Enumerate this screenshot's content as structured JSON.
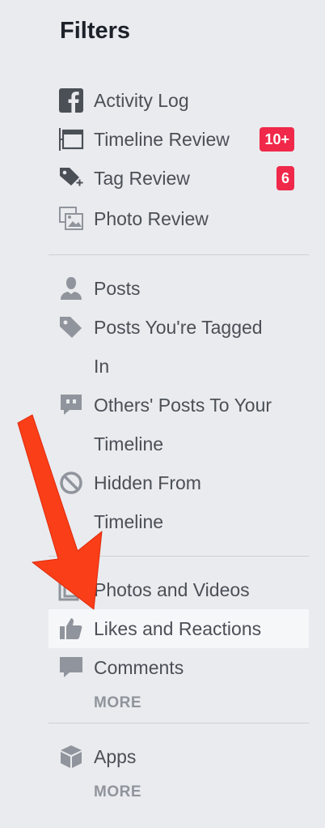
{
  "filters": {
    "title": "Filters",
    "group1": [
      {
        "label": "Activity Log",
        "icon": "facebook-f-icon"
      },
      {
        "label": "Timeline Review",
        "icon": "timeline-review-icon",
        "badge": "10+"
      },
      {
        "label": "Tag Review",
        "icon": "tag-plus-icon",
        "badge": "6"
      },
      {
        "label": "Photo Review",
        "icon": "photo-review-icon"
      }
    ],
    "group2": [
      {
        "label": "Posts",
        "icon": "person-icon"
      },
      {
        "label_line1": "Posts You're Tagged",
        "label_line2": "In",
        "icon": "tag-icon"
      },
      {
        "label_line1": "Others' Posts To Your",
        "label_line2": "Timeline",
        "icon": "speech-bubble-quote-icon"
      },
      {
        "label_line1": "Hidden From",
        "label_line2": "Timeline",
        "icon": "blocked-circle-icon"
      }
    ],
    "group3": [
      {
        "label": "Photos and Videos",
        "icon": "photos-icon"
      },
      {
        "label": "Likes and Reactions",
        "icon": "thumbs-up-icon",
        "selected": true
      },
      {
        "label": "Comments",
        "icon": "comment-icon"
      }
    ],
    "group3_more": "MORE",
    "group4": [
      {
        "label": "Apps",
        "icon": "cube-icon"
      }
    ],
    "group4_more": "MORE"
  },
  "colors": {
    "badge": "#f02849",
    "arrow": "#fa3e17",
    "icon": "#90949c",
    "facebook_icon": "#4b4f56"
  }
}
